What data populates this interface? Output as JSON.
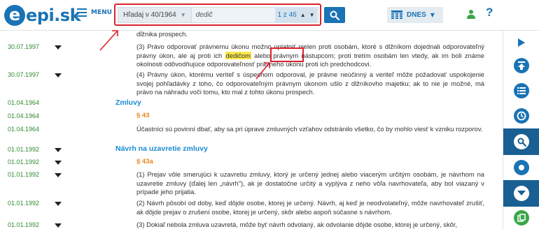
{
  "header": {
    "logo_text": "epi.sk",
    "menu_label": "MENU",
    "search": {
      "scope_label": "Hľadaj v 40/1964",
      "query": "dedič",
      "placeholder": "dedič",
      "counter": "1 z 46"
    },
    "date_label": "DNES"
  },
  "content": {
    "rows": [
      {
        "date": "",
        "arrow": false,
        "text": "dĺžnika prospech."
      },
      {
        "date": "30.07.1997",
        "arrow": true,
        "text_before": "(3) Právo odporovať právnemu úkonu možno uplatniť nielen proti osobám, ktoré s dlžníkom dojednali odporovateľný právny úkon, ale aj proti ich ",
        "highlight": "dedičom",
        "text_after": " alebo právnym nástupcom; proti tretím osobám len vtedy, ak im boli známe okolnosti odôvodňujúce odporovateľnosť právneho úkonu proti ich predchodcovi."
      },
      {
        "date": "30.07.1997",
        "arrow": true,
        "text": "(4) Právny úkon, ktorému veriteľ s úspechom odporoval, je právne neúčinný a veriteľ môže požadovať uspokojenie svojej pohľadávky z toho, čo odporovateľným právnym úkonom ušlo z dlžníkovho majetku; ak to nie je možné, má právo na náhradu voči tomu, kto mal z tohto úkonu prospech."
      },
      {
        "date": "01.04.1964",
        "arrow": false,
        "heading": "Zmluvy"
      },
      {
        "date": "01.04.1964",
        "arrow": false,
        "para": "§ 43"
      },
      {
        "date": "01.04.1964",
        "arrow": false,
        "text": "Účastníci sú povinní dbať, aby sa pri úprave zmluvných vzťahov odstránilo všetko, čo by mohlo viesť k vzniku rozporov."
      },
      {
        "date": "01.01.1992",
        "arrow": true,
        "heading": "Návrh na uzavretie zmluvy"
      },
      {
        "date": "01.01.1992",
        "arrow": true,
        "para": "§ 43a"
      },
      {
        "date": "01.01.1992",
        "arrow": true,
        "text": "(1) Prejav vôle smerujúci k uzavretiu zmluvy, ktorý je určený jednej alebo viacerým určitým osobám, je návrhom na uzavretie zmluvy (ďalej len „návrh\"), ak je dostatočne určitý a vyplýva z neho vôľa navrhovateľa, aby bol viazaný v prípade jeho prijatia."
      },
      {
        "date": "01.01.1992",
        "arrow": true,
        "text": "(2) Návrh pôsobí od doby, keď dôjde osobe, ktorej je určený. Návrh, aj keď je neodvolateľný, môže navrhovateľ zrušiť, ak dôjde prejav o zrušení osobe, ktorej je určený, skôr alebo aspoň súčasne s návrhom."
      },
      {
        "date": "01.01.1992",
        "arrow": true,
        "text": "(3) Dokiaľ nebola zmluva uzavretá, môže byť návrh odvolaný, ak odvolanie dôjde osobe, ktorej je určený, skôr,"
      }
    ]
  },
  "toolbar": {
    "items": [
      "expand",
      "top",
      "contents",
      "history",
      "search",
      "record",
      "down",
      "copy"
    ]
  },
  "colors": {
    "brand": "#1a73b5",
    "date_green": "#2e8b2e",
    "paragraph_orange": "#e8851b",
    "heading_blue": "#1a8ad4",
    "highlight": "#fbe84a",
    "annotation_red": "#d9232d"
  }
}
